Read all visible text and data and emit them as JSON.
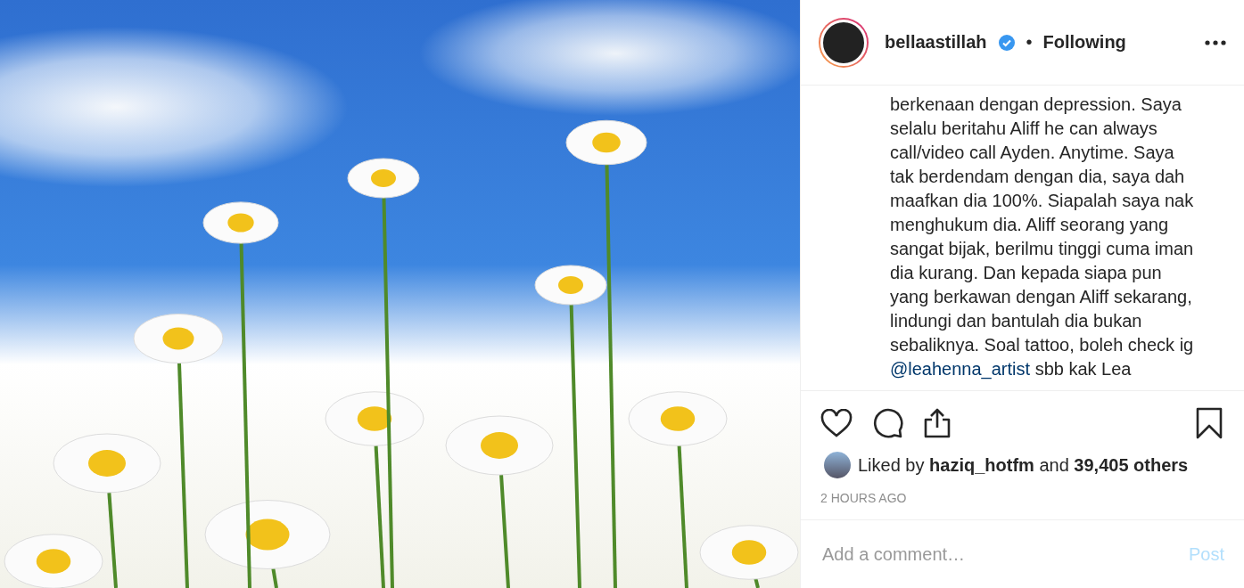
{
  "header": {
    "username": "bellaastillah",
    "verified": true,
    "separator": "•",
    "follow_status": "Following"
  },
  "caption": {
    "text_before": "berkenaan dengan depression. Saya selalu beritahu Aliff he can always call/video call Ayden. Anytime. Saya tak berdendam dengan dia, saya dah maafkan dia 100%. Siapalah saya nak menghukum dia. Aliff seorang yang sangat bijak, berilmu tinggi cuma iman dia kurang. Dan kepada siapa pun yang berkawan dengan Aliff sekarang, lindungi dan bantulah dia bukan sebaliknya. Soal tattoo, boleh check ig",
    "mention": "@leahenna_artist",
    "text_after": "sbb kak Lea"
  },
  "actions": {
    "liked": false,
    "saved": false
  },
  "likes": {
    "prefix": "Liked by",
    "user": "haziq_hotfm",
    "middle": "and",
    "count": "39,405 others"
  },
  "timestamp": "2 HOURS AGO",
  "comment": {
    "placeholder": "Add a comment…",
    "post_label": "Post",
    "disabled": true
  }
}
